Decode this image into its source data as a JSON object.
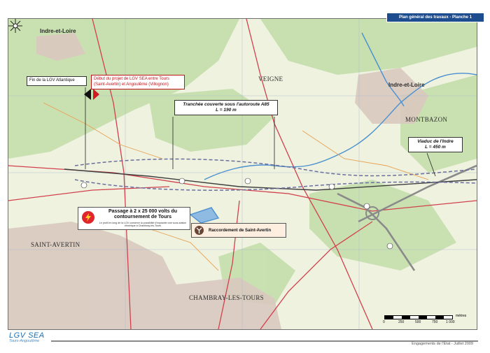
{
  "title_box": "Plan général des travaux - Planche 1",
  "towns": {
    "indre_et_loire_nw": "Indre-et-Loire",
    "veigne": "VEIGNE",
    "indre_et_loire_e": "Indre-et-Loire",
    "montbazon": "MONTBAZON",
    "saint_avertin": "SAINT-AVERTIN",
    "chambray": "CHAMBRAY-LES-TOURS"
  },
  "callouts": {
    "fin_lgv": "Fin de la LGV Atlantique",
    "debut_projet": "Début du projet de LGV SEA entre Tours (Saint-Avertin) et Angoulême (Villognon)",
    "tranchee_line1": "Tranchée couverte sous l'autoroute A85",
    "tranchee_line2": "L = 190 m",
    "viaduc_line1": "Viaduc de l'Indre",
    "viaduc_line2": "L = 450 m"
  },
  "power_box": {
    "title": "Passage à 2 x 25 000 volts du contournement de Tours",
    "desc": "Le profil en long de la LGV conserve la possibilité d'implanter une sous-station électrique à Chambray-lès-Tours"
  },
  "raccordement": {
    "label": "Raccordement de Saint-Avertin"
  },
  "scale": {
    "ticks": [
      "0",
      "250",
      "500",
      "750",
      "1 000"
    ],
    "unit": "mètres"
  },
  "footer": {
    "logo_main": "LGV SEA",
    "logo_sub": "Tours-Angoulême",
    "right": "Engagements de l'État - Juillet 2009"
  },
  "colors": {
    "title_bg": "#1e4d8f",
    "lgv_line": "#6b6f9e",
    "roads": "#d2404d",
    "river": "#4a90d0",
    "forest": "#cfe3b5"
  },
  "icons": {
    "compass": "compass-rose-icon",
    "power": "lightning-icon",
    "raccordement": "junction-icon"
  }
}
